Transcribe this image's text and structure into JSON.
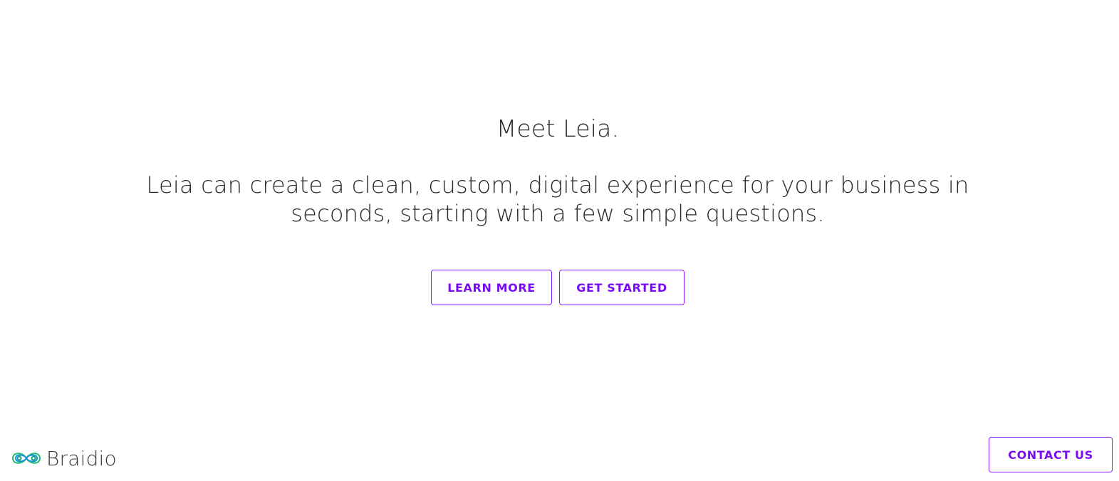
{
  "hero": {
    "headline": "Meet Leia.",
    "tagline": "Leia can create a clean, custom, digital experience for your business in seconds, starting with a few simple questions."
  },
  "actions": {
    "learn_more": "LEARN MORE",
    "get_started": "GET STARTED"
  },
  "footer": {
    "brand": "Braidio",
    "contact": "CONTACT US"
  },
  "colors": {
    "accent": "#7a0cf5",
    "text": "#2a2a2a",
    "logo_green": "#1bbf74",
    "logo_blue": "#1a8fd6"
  },
  "icons": {
    "logo": "braidio-infinity-logo-icon"
  }
}
